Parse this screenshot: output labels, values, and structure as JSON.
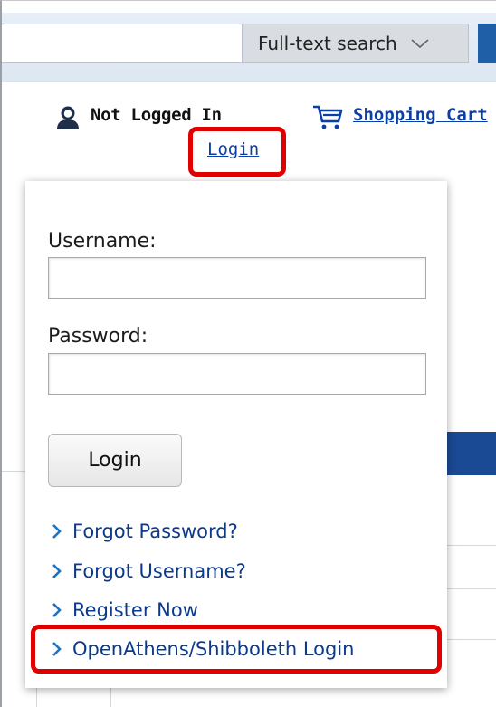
{
  "search": {
    "type_label": "Full-text search"
  },
  "header": {
    "status_text": "Not Logged In",
    "login_link": "Login",
    "cart_link": "Shopping Cart"
  },
  "login_panel": {
    "username_label": "Username:",
    "password_label": "Password:",
    "username_value": "",
    "password_value": "",
    "login_button": "Login",
    "links": [
      "Forgot Password?",
      "Forgot Username?",
      "Register Now",
      "OpenAthens/Shibboleth Login"
    ]
  },
  "colors": {
    "link": "#0b3a8c",
    "highlight": "#e00000",
    "accent": "#1f5fa8"
  }
}
